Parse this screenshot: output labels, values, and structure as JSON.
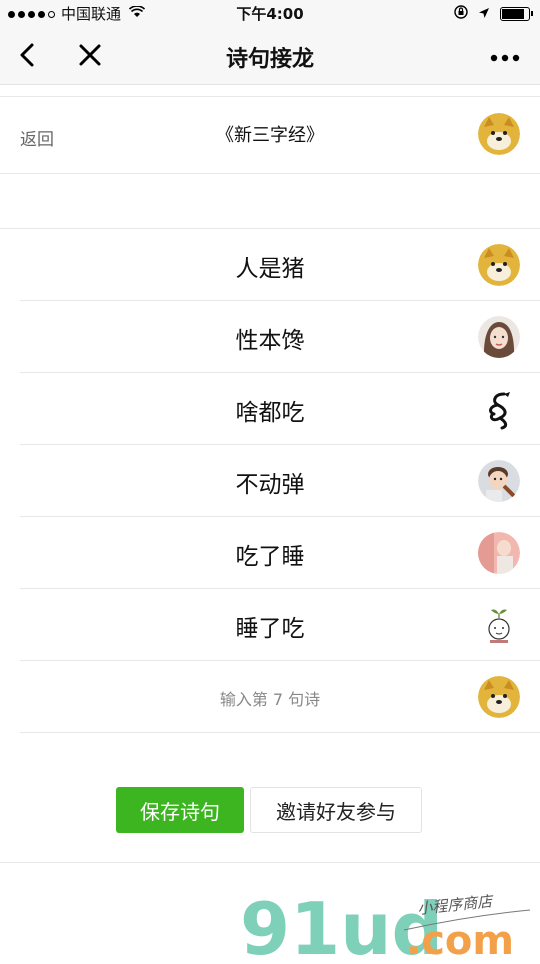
{
  "status": {
    "carrier": "中国联通",
    "time": "下午4:00",
    "battery_level": 0.9
  },
  "nav": {
    "title": "诗句接龙"
  },
  "header": {
    "back_label": "返回",
    "poem_title": "《新三字经》"
  },
  "lines": [
    {
      "text": "人是猪",
      "avatar": "doge-avatar"
    },
    {
      "text": "性本馋",
      "avatar": "girl-avatar"
    },
    {
      "text": "啥都吃",
      "avatar": "dragon-avatar"
    },
    {
      "text": "不动弹",
      "avatar": "child-avatar"
    },
    {
      "text": "吃了睡",
      "avatar": "pink-avatar"
    },
    {
      "text": "睡了吃",
      "avatar": "sprout-avatar"
    }
  ],
  "input": {
    "placeholder": "输入第 7 句诗"
  },
  "actions": {
    "save_label": "保存诗句",
    "invite_label": "邀请好友参与"
  },
  "watermark": {
    "brand": "91ud",
    "domain": ".com",
    "tagline": "小程序商店"
  },
  "colors": {
    "primary_green": "#3cb521",
    "nav_bg": "#f7f7f7",
    "divider": "#e8e8e8"
  }
}
